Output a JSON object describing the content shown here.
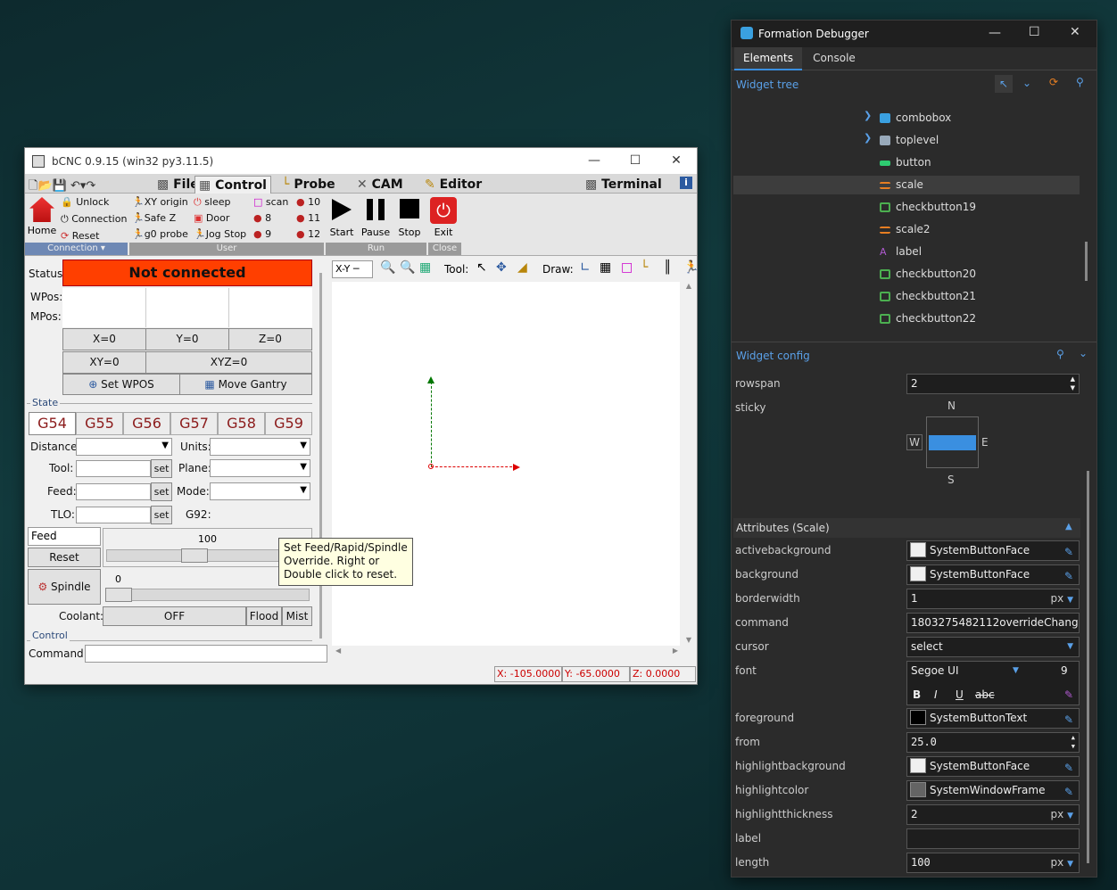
{
  "bcnc": {
    "title": "bCNC 0.9.15 (win32 py3.11.5)",
    "tabs": [
      "File",
      "Control",
      "Probe",
      "CAM",
      "Editor"
    ],
    "terminal_tab": "Terminal",
    "connection_group": {
      "home": "Home",
      "unlock": "Unlock",
      "connection": "Connection",
      "reset": "Reset",
      "label": "Connection ▾"
    },
    "user_group": {
      "xy_origin": "XY origin",
      "safe_z": "Safe Z",
      "g0_probe": "g0 probe",
      "sleep": "sleep",
      "door": "Door",
      "jog_stop": "Jog Stop",
      "scan": "scan",
      "n8": "8",
      "n9": "9",
      "n10": "10",
      "n11": "11",
      "n12": "12",
      "label": "User"
    },
    "run_group": {
      "start": "Start",
      "pause": "Pause",
      "stop": "Stop",
      "label": "Run"
    },
    "close_group": {
      "exit": "Exit",
      "label": "Close"
    },
    "status_label": "Status:",
    "status_value": "Not connected",
    "wpos_label": "WPos:",
    "mpos_label": "MPos:",
    "zero_buttons": [
      "X=0",
      "Y=0",
      "Z=0"
    ],
    "xy0": "XY=0",
    "xyz0": "XYZ=0",
    "set_wpos": "Set WPOS",
    "move_gantry": "Move Gantry",
    "state_label": "State",
    "gcodes": [
      "G54",
      "G55",
      "G56",
      "G57",
      "G58",
      "G59"
    ],
    "distance_label": "Distance:",
    "units_label": "Units:",
    "tool_label": "Tool:",
    "plane_label": "Plane:",
    "feed_label": "Feed:",
    "mode_label": "Mode:",
    "tlo_label": "TLO:",
    "g92_label": "G92:",
    "set": "set",
    "override_select": "Feed",
    "override_value": "100",
    "reset": "Reset",
    "spindle": "Spindle",
    "spindle_value": "0",
    "coolant_label": "Coolant:",
    "coolant_off": "OFF",
    "flood": "Flood",
    "mist": "Mist",
    "control_label": "Control",
    "command_label": "Command:",
    "tooltip": "Set Feed/Rapid/Spindle Override. Right or Double click to reset.",
    "view_select": "X-Y",
    "tool_label2": "Tool:",
    "draw_label": "Draw:",
    "coords": {
      "x": "X: -105.0000",
      "y": "Y: -65.0000",
      "z": "Z: 0.0000"
    }
  },
  "debugger": {
    "title": "Formation Debugger",
    "tabs": [
      "Elements",
      "Console"
    ],
    "tree_label": "Widget tree",
    "tree_items": [
      {
        "name": "combobox",
        "icon": "combobox-icon",
        "color": "#3aa0e0"
      },
      {
        "name": "toplevel",
        "icon": "toplevel-icon",
        "color": "#9ab"
      },
      {
        "name": "button",
        "icon": "button-icon",
        "color": "#2ecc71"
      },
      {
        "name": "scale",
        "icon": "scale-icon",
        "color": "#e67e22"
      },
      {
        "name": "checkbutton19",
        "icon": "checkbox-icon",
        "color": "#4caf50"
      },
      {
        "name": "scale2",
        "icon": "scale-icon",
        "color": "#e67e22"
      },
      {
        "name": "label",
        "icon": "label-icon",
        "color": "#b05ad0"
      },
      {
        "name": "checkbutton20",
        "icon": "checkbox-icon",
        "color": "#4caf50"
      },
      {
        "name": "checkbutton21",
        "icon": "checkbox-icon",
        "color": "#4caf50"
      },
      {
        "name": "checkbutton22",
        "icon": "checkbox-icon",
        "color": "#4caf50"
      }
    ],
    "config_label": "Widget config",
    "rowspan_label": "rowspan",
    "rowspan_value": "2",
    "sticky_label": "sticky",
    "sticky": {
      "n": "N",
      "s": "S",
      "w": "W",
      "e": "E"
    },
    "attributes_label": "Attributes (Scale)",
    "attrs": [
      {
        "name": "activebackground",
        "value": "SystemButtonFace",
        "swatch": "#f0f0f0"
      },
      {
        "name": "background",
        "value": "SystemButtonFace",
        "swatch": "#f0f0f0"
      },
      {
        "name": "borderwidth",
        "value": "1",
        "unit": "px"
      },
      {
        "name": "command",
        "value": "1803275482112overrideChange"
      },
      {
        "name": "cursor",
        "value": "select"
      },
      {
        "name": "font",
        "value": "Segoe UI",
        "size": "9"
      },
      {
        "name": "foreground",
        "value": "SystemButtonText",
        "swatch": "#000000"
      },
      {
        "name": "from",
        "value": "25.0"
      },
      {
        "name": "highlightbackground",
        "value": "SystemButtonFace",
        "swatch": "#f0f0f0"
      },
      {
        "name": "highlightcolor",
        "value": "SystemWindowFrame",
        "swatch": "#646464"
      },
      {
        "name": "highlightthickness",
        "value": "2",
        "unit": "px"
      },
      {
        "name": "label",
        "value": ""
      },
      {
        "name": "length",
        "value": "100",
        "unit": "px"
      }
    ],
    "font_styles": {
      "b": "B",
      "i": "I",
      "u": "U",
      "s": "abc"
    }
  }
}
